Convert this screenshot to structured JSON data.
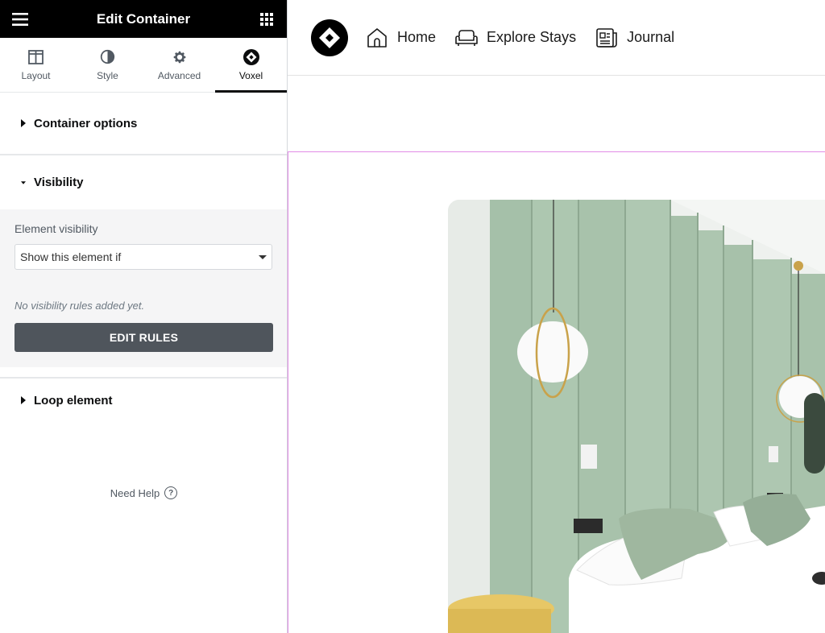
{
  "panel": {
    "title": "Edit Container",
    "tabs": [
      {
        "label": "Layout",
        "icon": "layout-icon"
      },
      {
        "label": "Style",
        "icon": "contrast-icon"
      },
      {
        "label": "Advanced",
        "icon": "gear-icon"
      },
      {
        "label": "Voxel",
        "icon": "voxel-icon"
      }
    ],
    "active_tab": "Voxel",
    "sections": {
      "container_options": "Container options",
      "visibility": "Visibility",
      "loop_element": "Loop element"
    },
    "visibility": {
      "field_label": "Element visibility",
      "select_value": "Show this element if",
      "note": "No visibility rules added yet.",
      "button": "EDIT RULES"
    },
    "help": "Need Help"
  },
  "nav": {
    "items": [
      {
        "label": "Home",
        "icon": "home-icon"
      },
      {
        "label": "Explore Stays",
        "icon": "sofa-icon"
      },
      {
        "label": "Journal",
        "icon": "newspaper-icon"
      }
    ]
  },
  "colors": {
    "panel_header_bg": "#000000",
    "button_bg": "#4f555c",
    "selection_outline": "#e18ce6",
    "wall_green": "#a9c3ad"
  }
}
